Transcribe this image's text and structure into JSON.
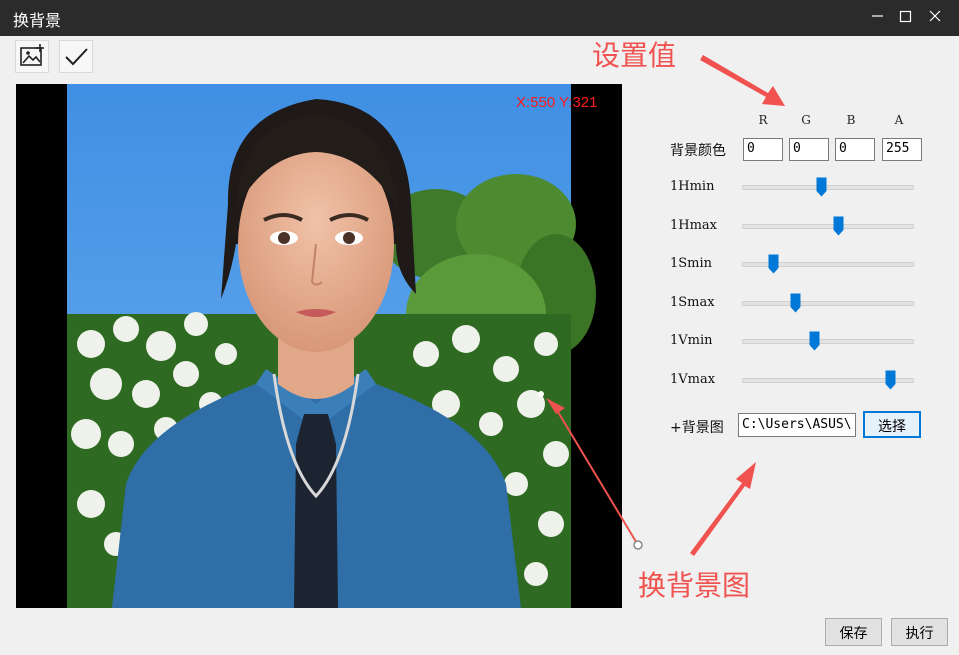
{
  "window": {
    "title": "换背景"
  },
  "toolbar": {
    "image_icon": "add-image-icon",
    "confirm_icon": "checkmark-icon"
  },
  "preview": {
    "coordinate_readout": "X:550 Y:321"
  },
  "color": {
    "columns": [
      "R",
      "G",
      "B",
      "A"
    ],
    "label": "背景颜色",
    "values": [
      "0",
      "0",
      "0",
      "255"
    ]
  },
  "sliders": [
    {
      "label": "1Hmin",
      "value": 0.46
    },
    {
      "label": "1Hmax",
      "value": 0.56
    },
    {
      "label": "1Smin",
      "value": 0.18
    },
    {
      "label": "1Smax",
      "value": 0.31
    },
    {
      "label": "1Vmin",
      "value": 0.42
    },
    {
      "label": "1Vmax",
      "value": 0.86
    }
  ],
  "background": {
    "label": "+背景图",
    "path": "C:\\Users\\ASUS\\",
    "choose_label": "选择"
  },
  "footer": {
    "save_label": "保存",
    "run_label": "执行"
  },
  "annotations": {
    "set_values": "设置值",
    "change_bg": "换背景图"
  },
  "colors": {
    "accent": "#0078d7",
    "annotation": "#f0524f",
    "readout": "#ff1a1a"
  }
}
